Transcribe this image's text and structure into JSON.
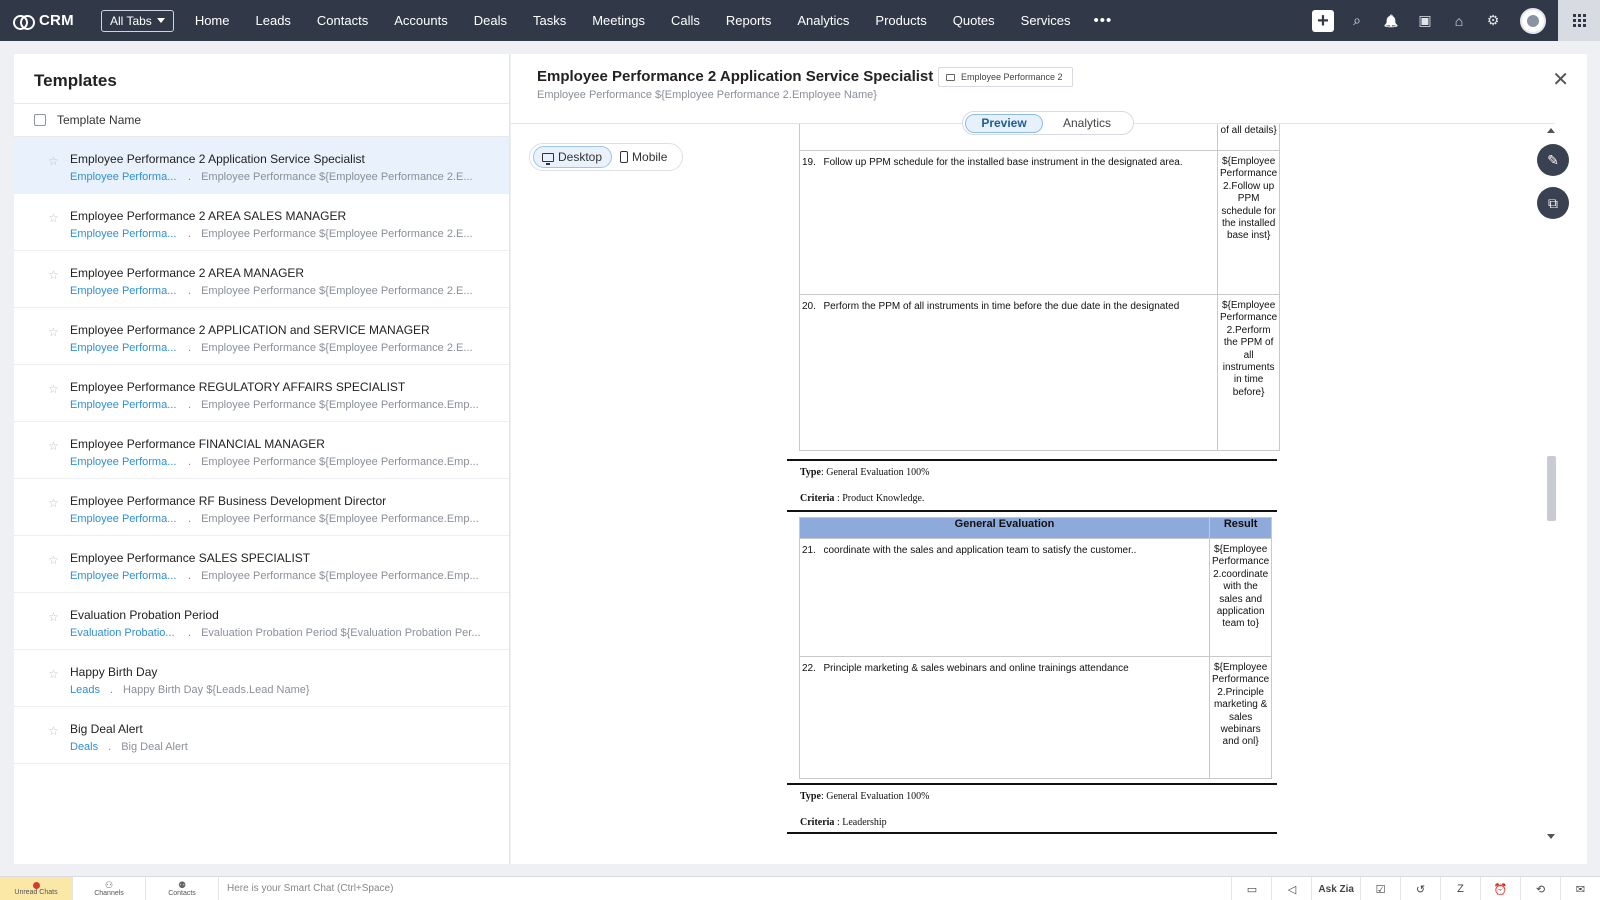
{
  "app": {
    "logo_text": "CRM",
    "all_tabs_label": "All Tabs"
  },
  "nav": {
    "tabs": [
      "Home",
      "Leads",
      "Contacts",
      "Accounts",
      "Deals",
      "Tasks",
      "Meetings",
      "Calls",
      "Reports",
      "Analytics",
      "Products",
      "Quotes",
      "Services"
    ],
    "more_label": "•••"
  },
  "icons": {
    "plus": "plus-icon",
    "search": "search-icon",
    "bell": "bell-icon",
    "calendar": "calendar-icon",
    "store": "marketplace-icon",
    "gear": "gear-icon",
    "apps": "apps-grid-icon",
    "close": "close-icon",
    "edit": "pencil-icon",
    "clone": "copy-icon",
    "star": "star-icon"
  },
  "icon_glyphs": {
    "search": "⌕",
    "bell": "🔔",
    "calendar": "▣",
    "store": "⌂",
    "gear": "⚙",
    "close": "✕",
    "edit": "✎",
    "clone": "⧉",
    "star": "☆"
  },
  "templates_panel": {
    "title": "Templates",
    "column_header": "Template Name",
    "items": [
      {
        "name": "Employee Performance 2 Application Service Specialist",
        "module": "Employee Performa...",
        "subject": "Employee Performance ${Employee Performance 2.E...",
        "selected": true
      },
      {
        "name": "Employee Performance 2 AREA SALES MANAGER",
        "module": "Employee Performa...",
        "subject": "Employee Performance ${Employee Performance 2.E..."
      },
      {
        "name": "Employee Performance 2 AREA MANAGER",
        "module": "Employee Performa...",
        "subject": "Employee Performance ${Employee Performance 2.E..."
      },
      {
        "name": "Employee Performance 2 APPLICATION and SERVICE MANAGER",
        "module": "Employee Performa...",
        "subject": "Employee Performance ${Employee Performance 2.E..."
      },
      {
        "name": "Employee Performance REGULATORY AFFAIRS SPECIALIST",
        "module": "Employee Performa...",
        "subject": "Employee Performance ${Employee Performance.Emp..."
      },
      {
        "name": "Employee Performance FINANCIAL MANAGER",
        "module": "Employee Performa...",
        "subject": "Employee Performance ${Employee Performance.Emp..."
      },
      {
        "name": "Employee Performance RF Business Development Director",
        "module": "Employee Performa...",
        "subject": "Employee Performance ${Employee Performance.Emp..."
      },
      {
        "name": "Employee Performance SALES SPECIALIST",
        "module": "Employee Performa...",
        "subject": "Employee Performance ${Employee Performance.Emp..."
      },
      {
        "name": "Evaluation Probation Period",
        "module": "Evaluation Probatio...",
        "subject": "Evaluation Probation Period ${Evaluation Probation Per..."
      },
      {
        "name": "Happy Birth Day",
        "module": "Leads",
        "subject": "Happy Birth Day ${Leads.Lead Name}"
      },
      {
        "name": "Big Deal Alert",
        "module": "Deals",
        "subject": "Big Deal Alert"
      }
    ],
    "separator": "."
  },
  "preview": {
    "title": "Employee Performance 2 Application Service Specialist",
    "folder_label": "Employee Performance 2",
    "subject": "Employee Performance ${Employee Performance 2.Employee Name}",
    "tabs": {
      "preview": "Preview",
      "analytics": "Analytics"
    },
    "device": {
      "desktop": "Desktop",
      "mobile": "Mobile"
    }
  },
  "document": {
    "top_fragment": "of all details}",
    "block1": [
      {
        "num": "19.",
        "text": "Follow up PPM schedule for the installed base instrument in the designated area.",
        "result": "${Employee Performance 2.Follow up PPM schedule for the installed base inst}"
      },
      {
        "num": "20.",
        "text": "Perform the PPM of all instruments in time before the due date in the designated",
        "result": "${Employee Performance 2.Perform the PPM of all instruments in time before}"
      }
    ],
    "section2": {
      "type_label": "Type",
      "type_value": ": General  Evaluation 100%",
      "criteria_label": "Criteria",
      "criteria_value": " : Product Knowledge."
    },
    "table2_header": {
      "col1": "General Evaluation",
      "col2": "Result"
    },
    "block2": [
      {
        "num": "21.",
        "text": "coordinate with the sales and application team to satisfy the customer..",
        "result": "${Employee Performance 2.coordinate with the sales and application team to}"
      },
      {
        "num": "22.",
        "text": "Principle marketing & sales webinars and online trainings attendance",
        "result": "${Employee Performance 2.Principle marketing & sales webinars and onl}"
      }
    ],
    "section3": {
      "type_label": "Type",
      "type_value": ": General  Evaluation 100%",
      "criteria_label": "Criteria",
      "criteria_value": " : Leadership"
    }
  },
  "bottom_bar": {
    "unread_chats": "Unread Chats",
    "channels": "Channels",
    "contacts": "Contacts",
    "smart_chat_placeholder": "Here is your Smart Chat (Ctrl+Space)",
    "ask_zia": "Ask Zia"
  }
}
